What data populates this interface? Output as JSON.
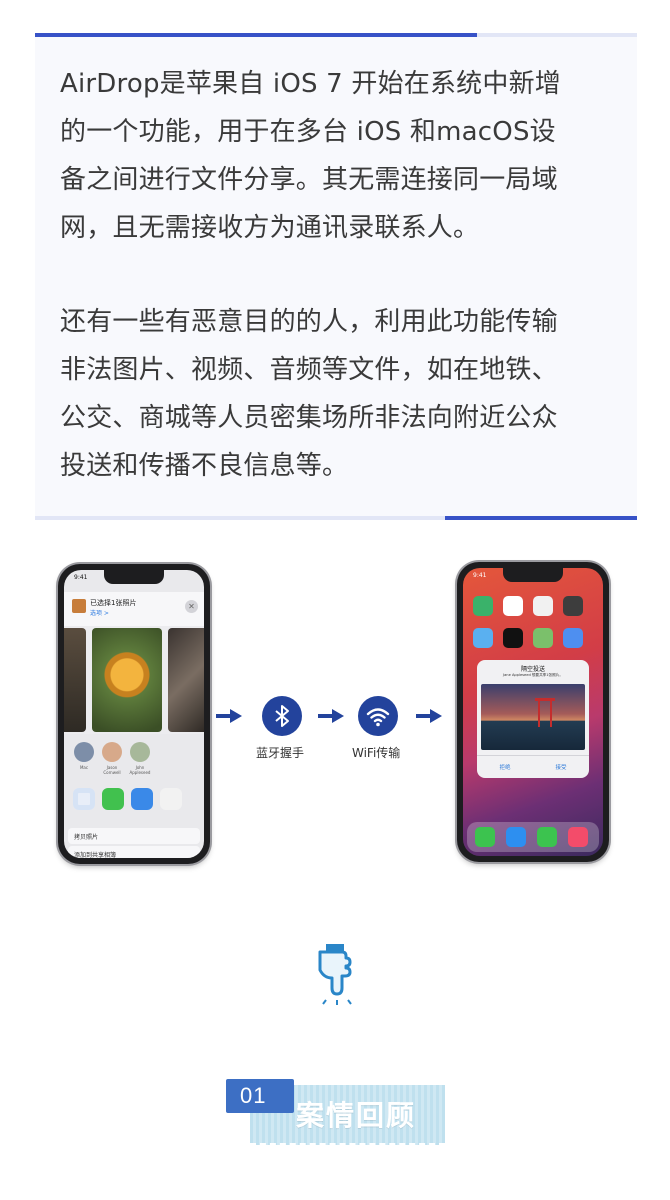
{
  "article": {
    "paragraph1": [
      "AirDrop是苹果自 iOS 7 开始在系统中新增",
      "的一个功能，用于在多台 iOS 和macOS设",
      "备之间进行文件分享。其无需连接同一局域",
      "网，且无需接收方为通讯录联系人。"
    ],
    "paragraph2": [
      "还有一些有恶意目的的人，利用此功能传输",
      "非法图片、视频、音频等文件，如在地铁、",
      "公交、商城等人员密集场所非法向附近公众",
      "投送和传播不良信息等。"
    ]
  },
  "diagram": {
    "step1_icon": "bluetooth-icon",
    "step1_label": "蓝牙握手",
    "step2_icon": "wifi-icon",
    "step2_label": "WiFi传输",
    "accent_color": "#23439c",
    "left_phone": {
      "time": "9:41",
      "share_title": "已选择1张照片",
      "share_subtitle": "选项 >",
      "people": [
        "Mac",
        "Jason Cornwell",
        "John Appleseed"
      ],
      "row1": "拷贝照片",
      "row2": "添加到共享相簿"
    },
    "right_phone": {
      "time": "9:41",
      "dialog_title": "隔空投送",
      "dialog_text": "Jane Appleseed 想要共享1张照片。",
      "decline": "拒绝",
      "accept": "接受"
    }
  },
  "badge": {
    "number": "01",
    "title": "案情回顾",
    "colors": {
      "tag": "#3d6fc4",
      "paper": "#c6e4f1"
    }
  },
  "colors": {
    "accent_bar": "#3752c7",
    "bar_track": "#e2e6f6",
    "panel_bg": "#f8f9fd",
    "text": "#3a3a3a"
  }
}
